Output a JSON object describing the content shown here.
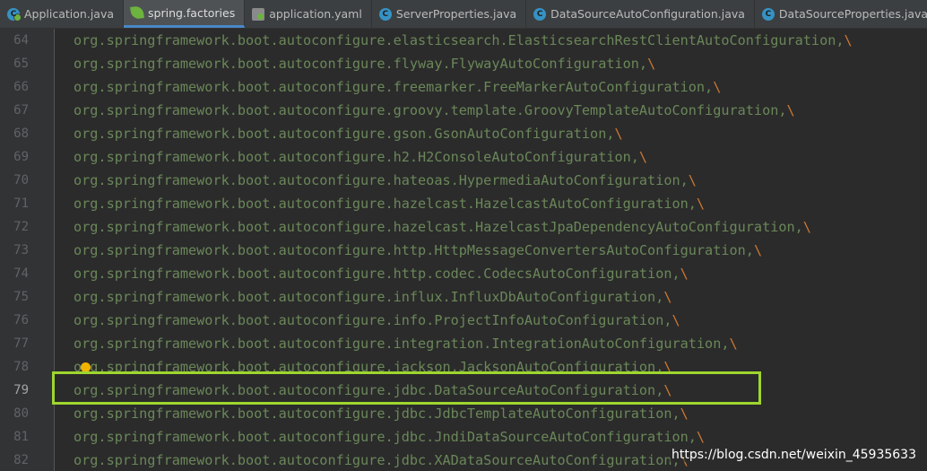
{
  "tabs": [
    {
      "label": "Application.java",
      "icon": "spring-boot-class-icon",
      "active": false
    },
    {
      "label": "spring.factories",
      "icon": "spring-leaf-icon",
      "active": true
    },
    {
      "label": "application.yaml",
      "icon": "yaml-config-icon",
      "active": false
    },
    {
      "label": "ServerProperties.java",
      "icon": "java-class-icon",
      "active": false
    },
    {
      "label": "DataSourceAutoConfiguration.java",
      "icon": "java-class-icon",
      "active": false
    },
    {
      "label": "DataSourceProperties.java",
      "icon": "java-class-icon",
      "active": false
    }
  ],
  "editor": {
    "current_line": "79",
    "lines": [
      {
        "num": "64",
        "text": "org.springframework.boot.autoconfigure.elasticsearch.ElasticsearchRestClientAutoConfiguration,",
        "cont": "\\"
      },
      {
        "num": "65",
        "text": "org.springframework.boot.autoconfigure.flyway.FlywayAutoConfiguration,",
        "cont": "\\"
      },
      {
        "num": "66",
        "text": "org.springframework.boot.autoconfigure.freemarker.FreeMarkerAutoConfiguration,",
        "cont": "\\"
      },
      {
        "num": "67",
        "text": "org.springframework.boot.autoconfigure.groovy.template.GroovyTemplateAutoConfiguration,",
        "cont": "\\"
      },
      {
        "num": "68",
        "text": "org.springframework.boot.autoconfigure.gson.GsonAutoConfiguration,",
        "cont": "\\"
      },
      {
        "num": "69",
        "text": "org.springframework.boot.autoconfigure.h2.H2ConsoleAutoConfiguration,",
        "cont": "\\"
      },
      {
        "num": "70",
        "text": "org.springframework.boot.autoconfigure.hateoas.HypermediaAutoConfiguration,",
        "cont": "\\"
      },
      {
        "num": "71",
        "text": "org.springframework.boot.autoconfigure.hazelcast.HazelcastAutoConfiguration,",
        "cont": "\\"
      },
      {
        "num": "72",
        "text": "org.springframework.boot.autoconfigure.hazelcast.HazelcastJpaDependencyAutoConfiguration,",
        "cont": "\\"
      },
      {
        "num": "73",
        "text": "org.springframework.boot.autoconfigure.http.HttpMessageConvertersAutoConfiguration,",
        "cont": "\\"
      },
      {
        "num": "74",
        "text": "org.springframework.boot.autoconfigure.http.codec.CodecsAutoConfiguration,",
        "cont": "\\"
      },
      {
        "num": "75",
        "text": "org.springframework.boot.autoconfigure.influx.InfluxDbAutoConfiguration,",
        "cont": "\\"
      },
      {
        "num": "76",
        "text": "org.springframework.boot.autoconfigure.info.ProjectInfoAutoConfiguration,",
        "cont": "\\"
      },
      {
        "num": "77",
        "text": "org.springframework.boot.autoconfigure.integration.IntegrationAutoConfiguration,",
        "cont": "\\"
      },
      {
        "num": "78",
        "text": "org.springframework.boot.autoconfigure.jackson.JacksonAutoConfiguration,",
        "cont": "\\"
      },
      {
        "num": "79",
        "text": "org.springframework.boot.autoconfigure.jdbc.DataSourceAutoConfiguration,",
        "cont": "\\"
      },
      {
        "num": "80",
        "text": "org.springframework.boot.autoconfigure.jdbc.JdbcTemplateAutoConfiguration,",
        "cont": "\\"
      },
      {
        "num": "81",
        "text": "org.springframework.boot.autoconfigure.jdbc.JndiDataSourceAutoConfiguration,",
        "cont": "\\"
      },
      {
        "num": "82",
        "text": "org.springframework.boot.autoconfigure.jdbc.XADataSourceAutoConfiguration,",
        "cont": "\\"
      }
    ]
  },
  "annotation": {
    "highlight_color": "#9ed62e"
  },
  "watermark": "https://blog.csdn.net/weixin_45935633",
  "colors": {
    "editor_bg": "#2b2b2b",
    "gutter_bg": "#313335",
    "string_green": "#6a8759",
    "line_number": "#606366",
    "accent_tab": "#4a88c7",
    "bulb": "#f0b400"
  }
}
